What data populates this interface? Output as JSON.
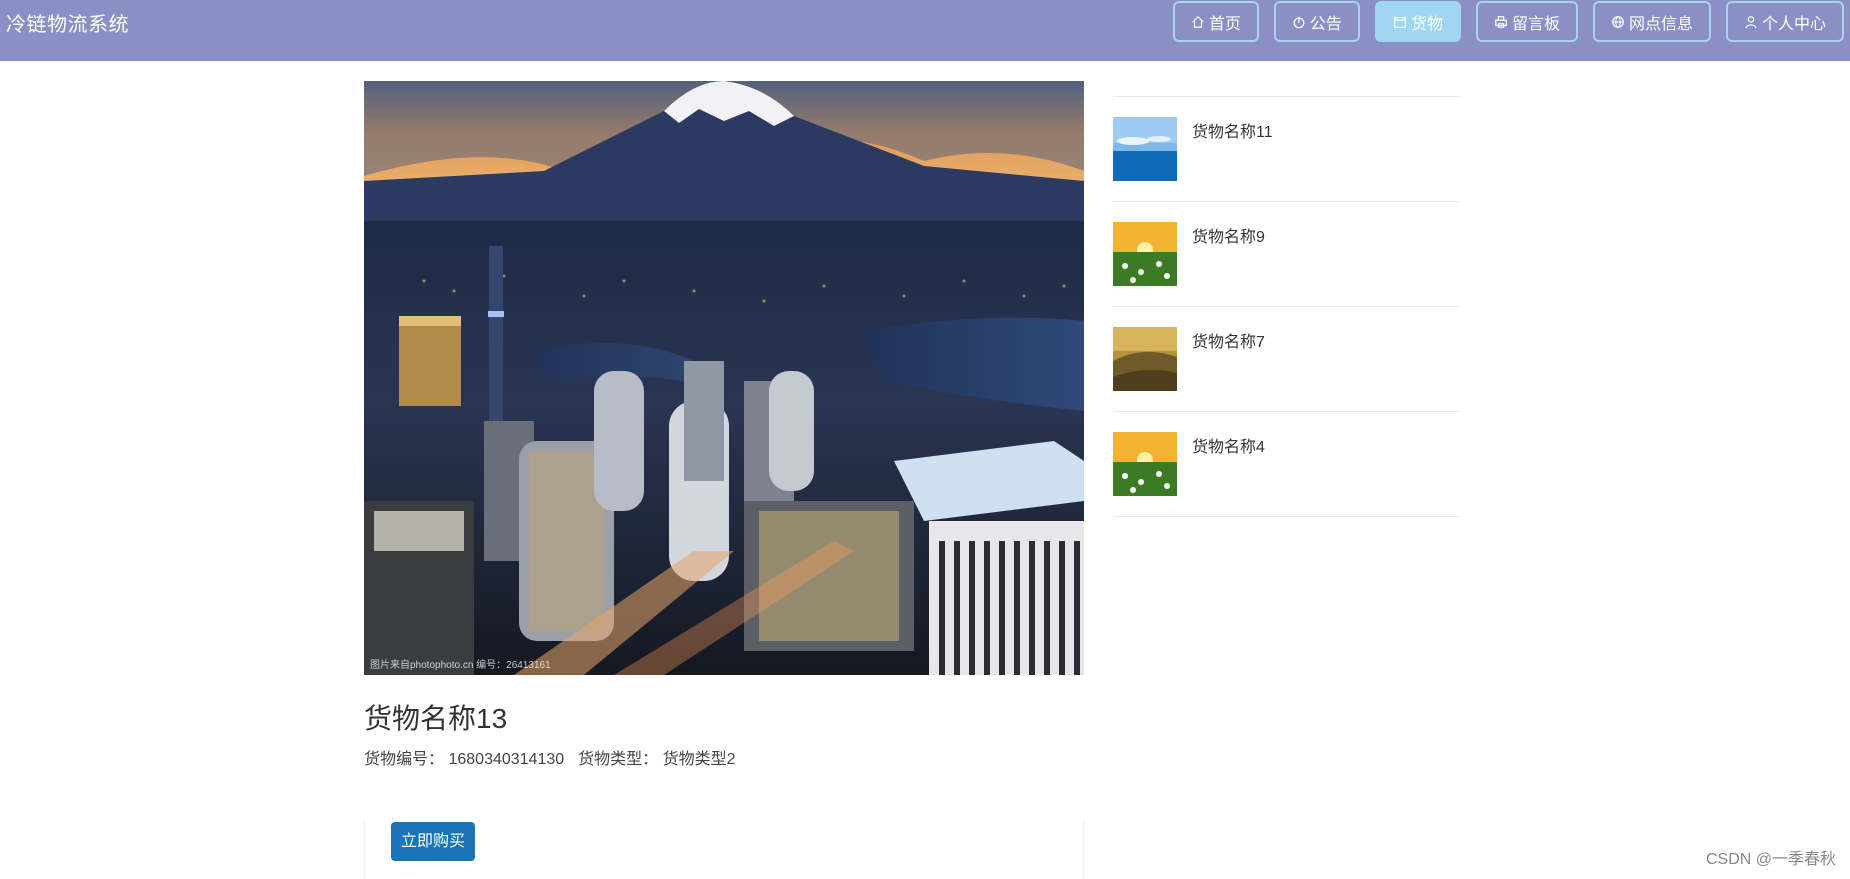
{
  "header": {
    "brand": "冷链物流系统",
    "nav": [
      {
        "label": "首页",
        "icon": "home-icon"
      },
      {
        "label": "公告",
        "icon": "power-icon"
      },
      {
        "label": "货物",
        "icon": "calendar-icon",
        "active": true
      },
      {
        "label": "留言板",
        "icon": "printer-icon"
      },
      {
        "label": "网点信息",
        "icon": "globe-icon"
      },
      {
        "label": "个人中心",
        "icon": "user-icon"
      }
    ]
  },
  "product": {
    "image_caption": "图片来自photophoto.cn 编号：26413161",
    "title": "货物名称13",
    "code_label": "货物编号：",
    "code_value": "1680340314130",
    "type_label": "货物类型：",
    "type_value": "货物类型2",
    "buy_label": "立即购买"
  },
  "related": [
    {
      "name": "货物名称11",
      "thumb": "sea-sky"
    },
    {
      "name": "货物名称9",
      "thumb": "flower-field"
    },
    {
      "name": "货物名称7",
      "thumb": "hill-sunset"
    },
    {
      "name": "货物名称4",
      "thumb": "flower-field"
    }
  ],
  "footer": {
    "watermark": "CSDN @一季春秋"
  },
  "colors": {
    "header_bg": "#8a8fc6",
    "nav_active": "#9fd6f1",
    "buy_button": "#1a73b5"
  }
}
